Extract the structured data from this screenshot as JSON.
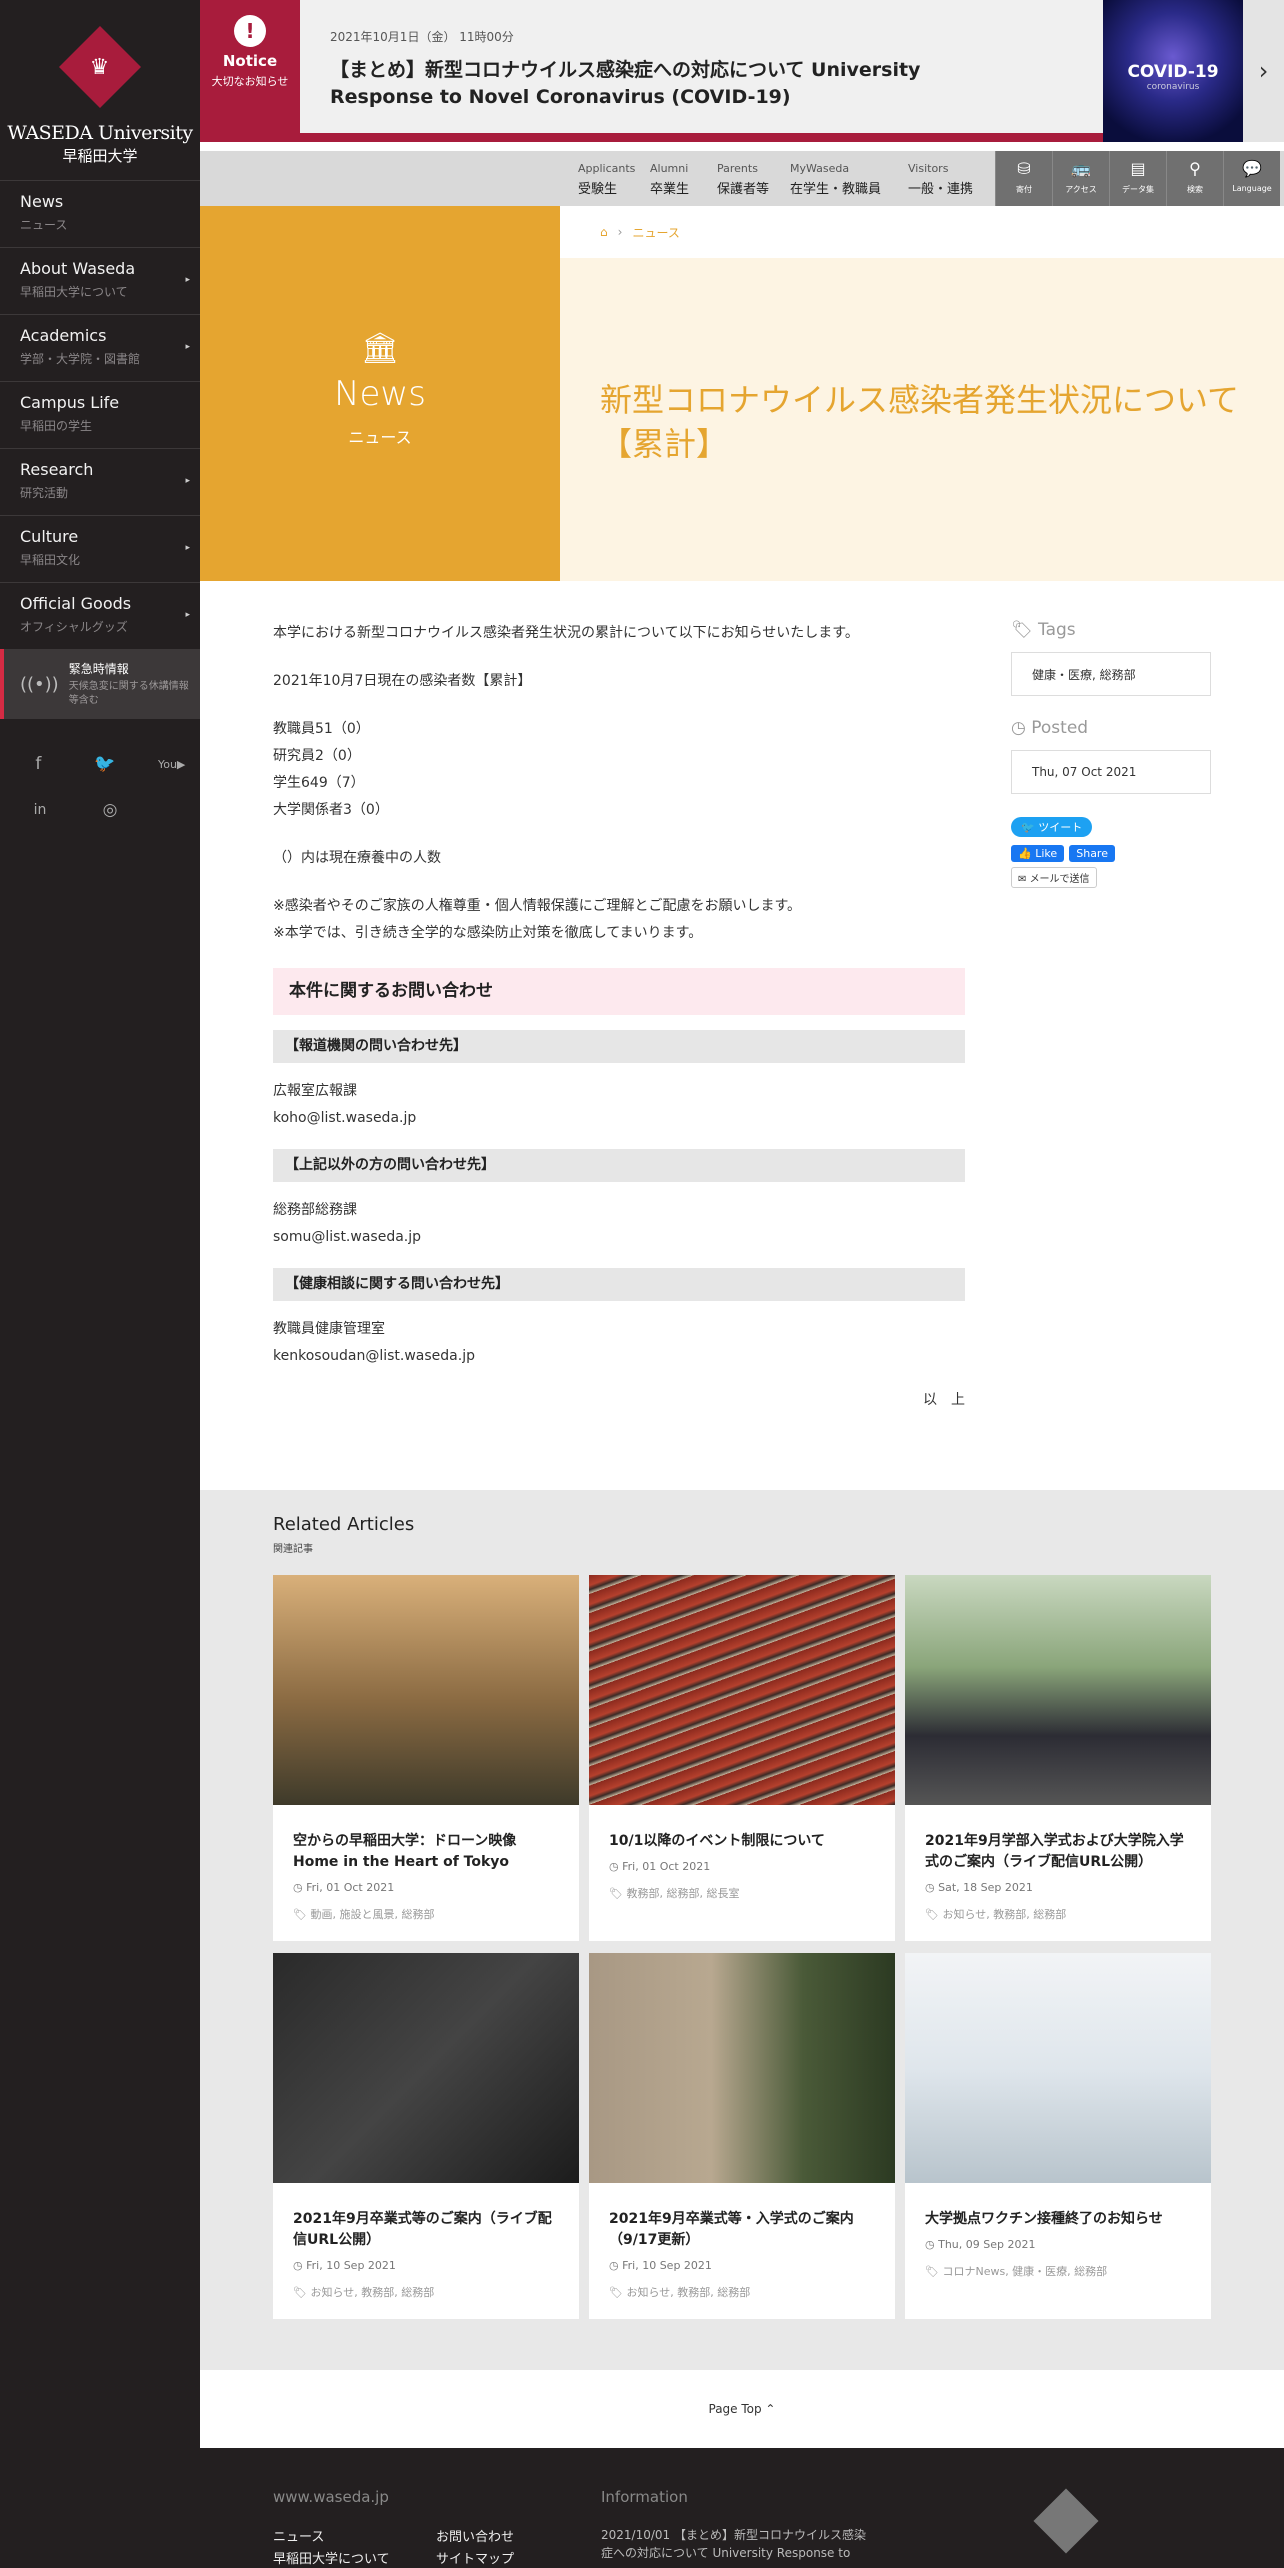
{
  "sidebar": {
    "logo_en": "WASEDA University",
    "logo_ja": "早稲田大学",
    "items": [
      {
        "en": "News",
        "ja": "ニュース",
        "arrow": ""
      },
      {
        "en": "About Waseda",
        "ja": "早稲田大学について",
        "arrow": "▸"
      },
      {
        "en": "Academics",
        "ja": "学部・大学院・図書館",
        "arrow": "▸"
      },
      {
        "en": "Campus Life",
        "ja": "早稲田の学生",
        "arrow": ""
      },
      {
        "en": "Research",
        "ja": "研究活動",
        "arrow": "▸"
      },
      {
        "en": "Culture",
        "ja": "早稲田文化",
        "arrow": "▸"
      },
      {
        "en": "Official Goods",
        "ja": "オフィシャルグッズ",
        "arrow": "▸"
      }
    ],
    "emergency": {
      "title": "緊急時情報",
      "desc1": "天候急変に関する休講情報",
      "desc2": "等含む"
    }
  },
  "notice": {
    "badge": "Notice",
    "badge_sub": "大切なお知らせ",
    "date": "2021年10月1日（金） 11時00分",
    "title": "【まとめ】新型コロナウイルス感染症への対応について University Response to Novel Coronavirus (COVID-19)",
    "thumb_title": "COVID-19",
    "thumb_sub": "coronavirus"
  },
  "topnav": {
    "audiences": [
      {
        "en": "Applicants",
        "ja": "受験生"
      },
      {
        "en": "Alumni",
        "ja": "卒業生"
      },
      {
        "en": "Parents",
        "ja": "保護者等"
      },
      {
        "en": "MyWaseda",
        "ja": "在学生・教職員"
      },
      {
        "en": "Visitors",
        "ja": "一般・連携"
      }
    ],
    "tools": [
      "寄付",
      "アクセス",
      "データ集",
      "検索",
      "Language"
    ]
  },
  "hero": {
    "section_en": "News",
    "section_ja": "ニュース",
    "breadcrumb": "ニュース",
    "title": "新型コロナウイルス感染者発生状況について【累計】"
  },
  "article": {
    "intro": "本学における新型コロナウイルス感染者発生状況の累計について以下にお知らせいたします。",
    "as_of": "2021年10月7日現在の感染者数【累計】",
    "counts": [
      "教職員51（0）",
      "研究員2（0）",
      "学生649（7）",
      "大学関係者3（0）"
    ],
    "note_paren": "（）内は現在療養中の人数",
    "note1": "※感染者やそのご家族の人権尊重・個人情報保護にご理解とご配慮をお願いします。",
    "note2": "※本学では、引き続き全学的な感染防止対策を徹底してまいります。",
    "contact_heading": "本件に関するお問い合わせ",
    "contacts": [
      {
        "heading": "【報道機関の問い合わせ先】",
        "org": "広報室広報課",
        "email": "koho@list.waseda.jp"
      },
      {
        "heading": "【上記以外の方の問い合わせ先】",
        "org": "総務部総務課",
        "email": "somu@list.waseda.jp"
      },
      {
        "heading": "【健康相談に関する問い合わせ先】",
        "org": "教職員健康管理室",
        "email": "kenkosoudan@list.waseda.jp"
      }
    ],
    "closing": "以　上"
  },
  "aside": {
    "tags_label": "Tags",
    "tags": "健康・医療, 総務部",
    "posted_label": "Posted",
    "posted": "Thu, 07 Oct 2021",
    "tweet": "ツイート",
    "like": "Like",
    "share": "Share",
    "mail": "メールで送信"
  },
  "related": {
    "heading": "Related Articles",
    "sub": "関連記事",
    "cards": [
      {
        "title": "空からの早稲田大学：ドローン映像 Home in the Heart of Tokyo",
        "date": "Fri, 01 Oct 2021",
        "tags": "動画, 施設と風景, 総務部"
      },
      {
        "title": "10/1以降のイベント制限について",
        "date": "Fri, 01 Oct 2021",
        "tags": "教務部, 総務部, 総長室"
      },
      {
        "title": "2021年9月学部入学式および大学院入学式のご案内（ライブ配信URL公開）",
        "date": "Sat, 18 Sep 2021",
        "tags": "お知らせ, 教務部, 総務部"
      },
      {
        "title": "2021年9月卒業式等のご案内（ライブ配信URL公開）",
        "date": "Fri, 10 Sep 2021",
        "tags": "お知らせ, 教務部, 総務部"
      },
      {
        "title": "2021年9月卒業式等・入学式のご案内（9/17更新）",
        "date": "Fri, 10 Sep 2021",
        "tags": "お知らせ, 教務部, 総務部"
      },
      {
        "title": "大学拠点ワクチン接種終了のお知らせ",
        "date": "Thu, 09 Sep 2021",
        "tags": "コロナNews, 健康・医療, 総務部"
      }
    ]
  },
  "pagetop": "Page Top ⌃",
  "footer": {
    "site": "www.waseda.jp",
    "info": "Information",
    "links": [
      "ニュース",
      "お問い合わせ",
      "早稲田大学について",
      "サイトマップ"
    ],
    "info_text1": "2021/10/01 【まとめ】新型コロナウイルス感染",
    "info_text2": "症への対応について University Response to"
  },
  "colors": {
    "brand": "#a81c3c",
    "accent": "#e5a530",
    "dark": "#231f20"
  }
}
